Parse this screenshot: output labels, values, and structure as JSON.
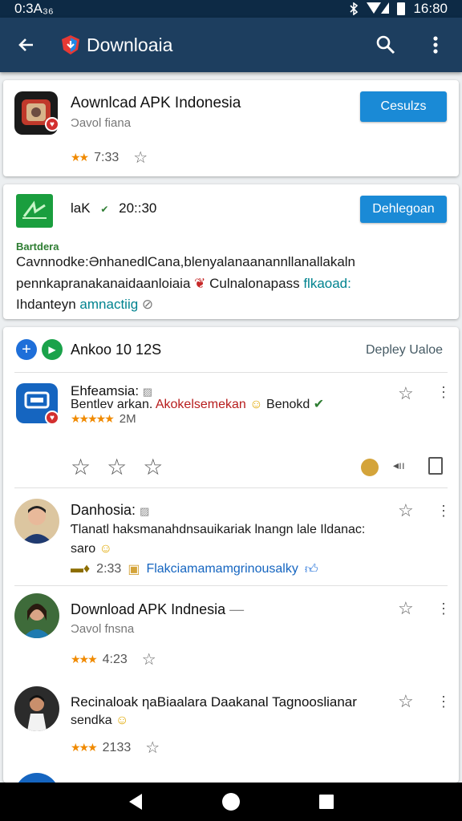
{
  "status": {
    "time": "0:3A₃₆",
    "right_time": "16:80"
  },
  "app_bar": {
    "title": "Downloaia",
    "back_icon": "arrow-back-icon",
    "search_icon": "search-icon",
    "menu_icon": "more-vert-icon"
  },
  "card1": {
    "title": "Aownlcad APK Indonesia",
    "subtitle": "Ɔavol fiana",
    "rating_time": "7:33",
    "button": "Cesulzs"
  },
  "card2": {
    "title": "ƖaK",
    "tick": "✔",
    "time": "20::30",
    "button": "Dehlegoan",
    "label": "Bartdera",
    "line1": "Cavnnodke:ƏnhanedlCana,blenyalanaanannllanallakaln",
    "line2a": "pennkapranakanaidaanloiaia",
    "line2b": "Culnalonapass",
    "line2c": "flkaoad:",
    "line3a": "Ihdanteyn",
    "line3b": "amnactiig"
  },
  "card3": {
    "header_title": "Ankoo 10 12S",
    "header_action": "Depley Ualoe",
    "items": [
      {
        "title": "Ehfeamsia:",
        "line1a": "Bentlev arkan.",
        "line1b": "Akokelsemekan",
        "line1c": "Benokd",
        "rating_count": "2M"
      },
      {
        "title": "Danhosia:",
        "line1": "Ƭlanatl haksmanahdnsauikariak lnangn lale Ildanac:",
        "line2": "saro",
        "meta_time": "2:33",
        "meta_link": "Flakciamamamgrinousalky"
      },
      {
        "title": "Download APK Indnesia",
        "dash": "—",
        "subtitle": "Ɔavol fnsna",
        "time": "4:23"
      },
      {
        "title": "Recinaloak ƞaBiaalara Daakanal Tagnooslianar",
        "line1": "sendka",
        "time": "2133"
      }
    ]
  },
  "nav": {
    "back": "back-icon",
    "home": "home-icon",
    "recents": "recents-icon"
  }
}
